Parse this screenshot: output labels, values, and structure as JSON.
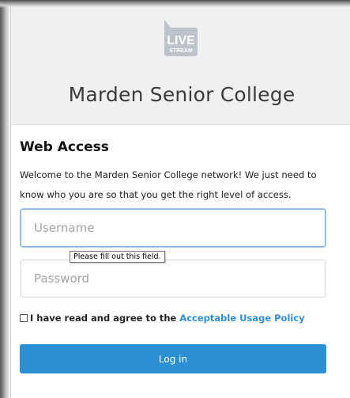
{
  "logo": {
    "line1": "LIVE",
    "line2": "STREAM",
    "icon": "livestream-speech-bubble-logo"
  },
  "header": {
    "title": "Marden Senior College"
  },
  "form": {
    "heading": "Web Access",
    "intro": "Welcome to the Marden Senior College network! We just need to know who you are so that you get the right level of access.",
    "username": {
      "value": "",
      "placeholder": "Username"
    },
    "password": {
      "value": "",
      "placeholder": "Password"
    },
    "validation_tooltip": "Please fill out this field.",
    "agree": {
      "text": "I have read and agree to the",
      "link": "Acceptable Usage Policy",
      "checked": false
    },
    "login_label": "Log in"
  },
  "colors": {
    "accent": "#2a8fd3",
    "link": "#2f8ed5",
    "header_bg": "#f0f0f0"
  }
}
